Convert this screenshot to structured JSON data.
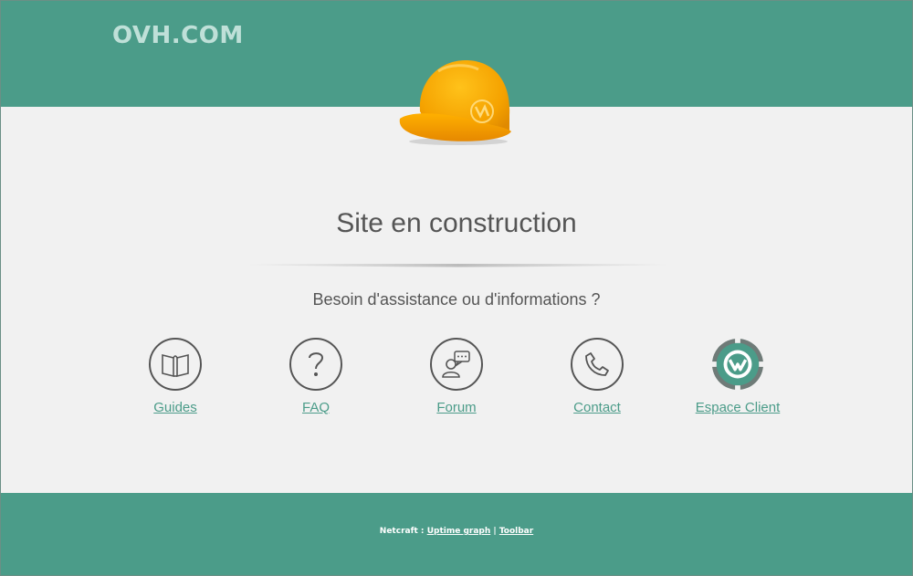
{
  "header": {
    "logo_text": "OVH.COM",
    "brand_color": "#4b9c89"
  },
  "helmet": {
    "icon": "construction-helmet-icon",
    "color": "#f5a200"
  },
  "main": {
    "title": "Site en construction",
    "subtitle": "Besoin d'assistance ou d'informations ?",
    "links": [
      {
        "label": "Guides",
        "icon": "book-icon"
      },
      {
        "label": "FAQ",
        "icon": "question-mark-icon"
      },
      {
        "label": "Forum",
        "icon": "forum-user-icon"
      },
      {
        "label": "Contact",
        "icon": "phone-icon"
      },
      {
        "label": "Espace Client",
        "icon": "customer-area-logo-icon"
      }
    ]
  },
  "footer": {
    "prefix": "Netcraft :",
    "uptime_label": "Uptime graph",
    "separator": "|",
    "toolbar_label": "Toolbar"
  }
}
